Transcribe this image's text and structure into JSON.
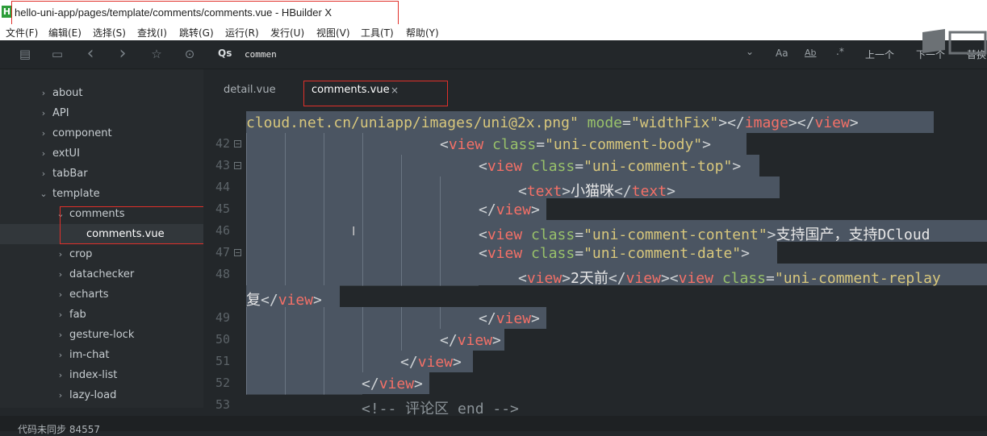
{
  "window": {
    "title": "hello-uni-app/pages/template/comments/comments.vue - HBuilder X",
    "app_icon": "H"
  },
  "menu": [
    "文件(F)",
    "编辑(E)",
    "选择(S)",
    "查找(I)",
    "跳转(G)",
    "运行(R)",
    "发行(U)",
    "视图(V)",
    "工具(T)",
    "帮助(Y)"
  ],
  "toolbar": {
    "search_value": "commen",
    "search_icon_label": "Qs",
    "case_label": "Aa",
    "word_label": "Ab",
    "regex_label": ".*",
    "prev_label": "上一个",
    "next_label": "下一个",
    "replace_label": "替换"
  },
  "sidebar": {
    "items": [
      {
        "label": "about",
        "arrow": "›",
        "level": 1
      },
      {
        "label": "API",
        "arrow": "›",
        "level": 1
      },
      {
        "label": "component",
        "arrow": "›",
        "level": 1
      },
      {
        "label": "extUI",
        "arrow": "›",
        "level": 1
      },
      {
        "label": "tabBar",
        "arrow": "›",
        "level": 1
      },
      {
        "label": "template",
        "arrow": "⌄",
        "level": 1
      },
      {
        "label": "comments",
        "arrow": "⌄",
        "level": 2
      },
      {
        "label": "comments.vue",
        "arrow": "",
        "level": 3
      },
      {
        "label": "crop",
        "arrow": "›",
        "level": 2
      },
      {
        "label": "datachecker",
        "arrow": "›",
        "level": 2
      },
      {
        "label": "echarts",
        "arrow": "›",
        "level": 2
      },
      {
        "label": "fab",
        "arrow": "›",
        "level": 2
      },
      {
        "label": "gesture-lock",
        "arrow": "›",
        "level": 2
      },
      {
        "label": "im-chat",
        "arrow": "›",
        "level": 2
      },
      {
        "label": "index-list",
        "arrow": "›",
        "level": 2
      },
      {
        "label": "lazy-load",
        "arrow": "›",
        "level": 2
      }
    ]
  },
  "tabs": [
    {
      "label": "detail.vue",
      "active": false
    },
    {
      "label": "comments.vue",
      "active": true,
      "close": "×"
    }
  ],
  "code": {
    "lines": [
      {
        "num": "",
        "tokens": [
          [
            "t-str",
            "cloud.net.cn/uniapp/images/uni@2x.png\""
          ],
          [
            "t-p",
            " "
          ],
          [
            "t-attr",
            "mode"
          ],
          [
            "t-p",
            "="
          ],
          [
            "t-str",
            "\"widthFix\""
          ],
          [
            "t-p",
            ">"
          ],
          [
            "t-p",
            "</"
          ],
          [
            "t-tag",
            "image"
          ],
          [
            "t-p",
            "></"
          ],
          [
            "t-tag",
            "view"
          ],
          [
            "t-p",
            ">"
          ]
        ]
      },
      {
        "num": "42",
        "fold": "−",
        "tokens": [
          [
            "t-p",
            "<"
          ],
          [
            "t-tag",
            "view"
          ],
          [
            "t-p",
            " "
          ],
          [
            "t-attr",
            "class"
          ],
          [
            "t-p",
            "="
          ],
          [
            "t-str",
            "\"uni-comment-body\""
          ],
          [
            "t-p",
            ">"
          ]
        ]
      },
      {
        "num": "43",
        "fold": "−",
        "tokens": [
          [
            "t-p",
            "<"
          ],
          [
            "t-tag",
            "view"
          ],
          [
            "t-p",
            " "
          ],
          [
            "t-attr",
            "class"
          ],
          [
            "t-p",
            "="
          ],
          [
            "t-str",
            "\"uni-comment-top\""
          ],
          [
            "t-p",
            ">"
          ]
        ]
      },
      {
        "num": "44",
        "tokens": [
          [
            "t-p",
            "<"
          ],
          [
            "t-tag",
            "text"
          ],
          [
            "t-p",
            ">"
          ],
          [
            "t-txt",
            "小猫咪"
          ],
          [
            "t-p",
            "</"
          ],
          [
            "t-tag",
            "text"
          ],
          [
            "t-p",
            ">"
          ]
        ]
      },
      {
        "num": "45",
        "tokens": [
          [
            "t-p",
            "</"
          ],
          [
            "t-tag",
            "view"
          ],
          [
            "t-p",
            ">"
          ]
        ]
      },
      {
        "num": "46",
        "tokens": [
          [
            "t-p",
            "<"
          ],
          [
            "t-tag",
            "view"
          ],
          [
            "t-p",
            " "
          ],
          [
            "t-attr",
            "class"
          ],
          [
            "t-p",
            "="
          ],
          [
            "t-str",
            "\"uni-comment-content\""
          ],
          [
            "t-p",
            ">"
          ],
          [
            "t-txt",
            "支持国产，支持DCloud"
          ]
        ]
      },
      {
        "num": "47",
        "fold": "−",
        "tokens": [
          [
            "t-p",
            "<"
          ],
          [
            "t-tag",
            "view"
          ],
          [
            "t-p",
            " "
          ],
          [
            "t-attr",
            "class"
          ],
          [
            "t-p",
            "="
          ],
          [
            "t-str",
            "\"uni-comment-date\""
          ],
          [
            "t-p",
            ">"
          ]
        ]
      },
      {
        "num": "48",
        "tokens": [
          [
            "t-p",
            "<"
          ],
          [
            "t-tag",
            "view"
          ],
          [
            "t-p",
            ">"
          ],
          [
            "t-txt",
            "2天前"
          ],
          [
            "t-p",
            "</"
          ],
          [
            "t-tag",
            "view"
          ],
          [
            "t-p",
            "><"
          ],
          [
            "t-tag",
            "view"
          ],
          [
            "t-p",
            " "
          ],
          [
            "t-attr",
            "class"
          ],
          [
            "t-p",
            "="
          ],
          [
            "t-str",
            "\"uni-comment-replay"
          ]
        ]
      },
      {
        "num": "",
        "tokens": [
          [
            "t-txt",
            "复"
          ],
          [
            "t-p",
            "</"
          ],
          [
            "t-tag",
            "view"
          ],
          [
            "t-p",
            ">"
          ]
        ]
      },
      {
        "num": "49",
        "tokens": [
          [
            "t-p",
            "</"
          ],
          [
            "t-tag",
            "view"
          ],
          [
            "t-p",
            ">"
          ]
        ]
      },
      {
        "num": "50",
        "tokens": [
          [
            "t-p",
            "</"
          ],
          [
            "t-tag",
            "view"
          ],
          [
            "t-p",
            ">"
          ]
        ]
      },
      {
        "num": "51",
        "tokens": [
          [
            "t-p",
            "</"
          ],
          [
            "t-tag",
            "view"
          ],
          [
            "t-p",
            ">"
          ]
        ]
      },
      {
        "num": "52",
        "tokens": [
          [
            "t-p",
            "</"
          ],
          [
            "t-tag",
            "view"
          ],
          [
            "t-p",
            ">"
          ]
        ]
      },
      {
        "num": "53",
        "tokens": [
          [
            "t-com",
            "<!-- 评论区 end -->"
          ]
        ]
      }
    ]
  },
  "status": {
    "text": "代码未同步  84557"
  },
  "colors": {
    "accent_red": "#e0302a",
    "selection": "#4b5562"
  }
}
